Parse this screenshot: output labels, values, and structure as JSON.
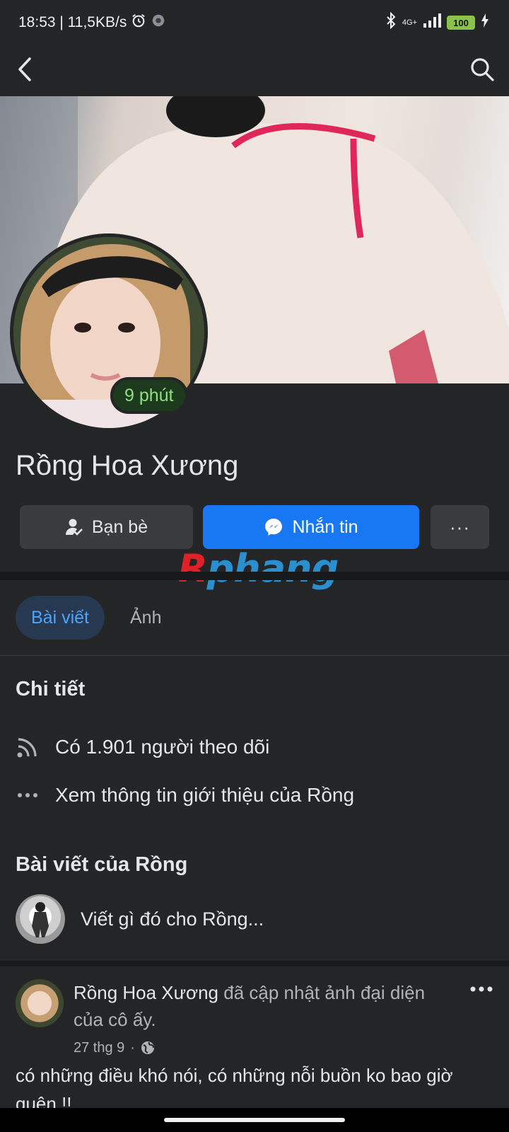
{
  "status_bar": {
    "time_speed": "18:53 | 11,5KB/s",
    "network": "4G+",
    "battery": "100"
  },
  "topbar": {
    "back_icon": "chevron-left-icon",
    "search_icon": "search-icon"
  },
  "profile": {
    "name": "Rồng Hoa Xương",
    "active_status": "9 phút"
  },
  "actions": {
    "friends_label": "Bạn bè",
    "message_label": "Nhắn tin",
    "more_label": "···"
  },
  "watermark": {
    "part1": "R",
    "part2": "phang"
  },
  "tabs": [
    {
      "label": "Bài viết",
      "active": true
    },
    {
      "label": "Ảnh",
      "active": false
    }
  ],
  "details": {
    "title": "Chi tiết",
    "followers": "Có 1.901 người theo dõi",
    "about": "Xem thông tin giới thiệu của Rồng"
  },
  "posts_section": {
    "title": "Bài viết của Rồng",
    "composer_placeholder": "Viết gì đó cho Rồng..."
  },
  "post": {
    "author": "Rồng Hoa Xương",
    "action": " đã cập nhật ảnh đại diện của cô ấy.",
    "date": "27 thg 9",
    "privacy_icon": "globe-icon",
    "text": "có những điều khó nói, có những nỗi buồn ko bao giờ quên !!"
  },
  "colors": {
    "background": "#242526",
    "accent": "#1877f2",
    "active_tab_text": "#4fa3f7",
    "presence_green": "#8ee07f"
  }
}
